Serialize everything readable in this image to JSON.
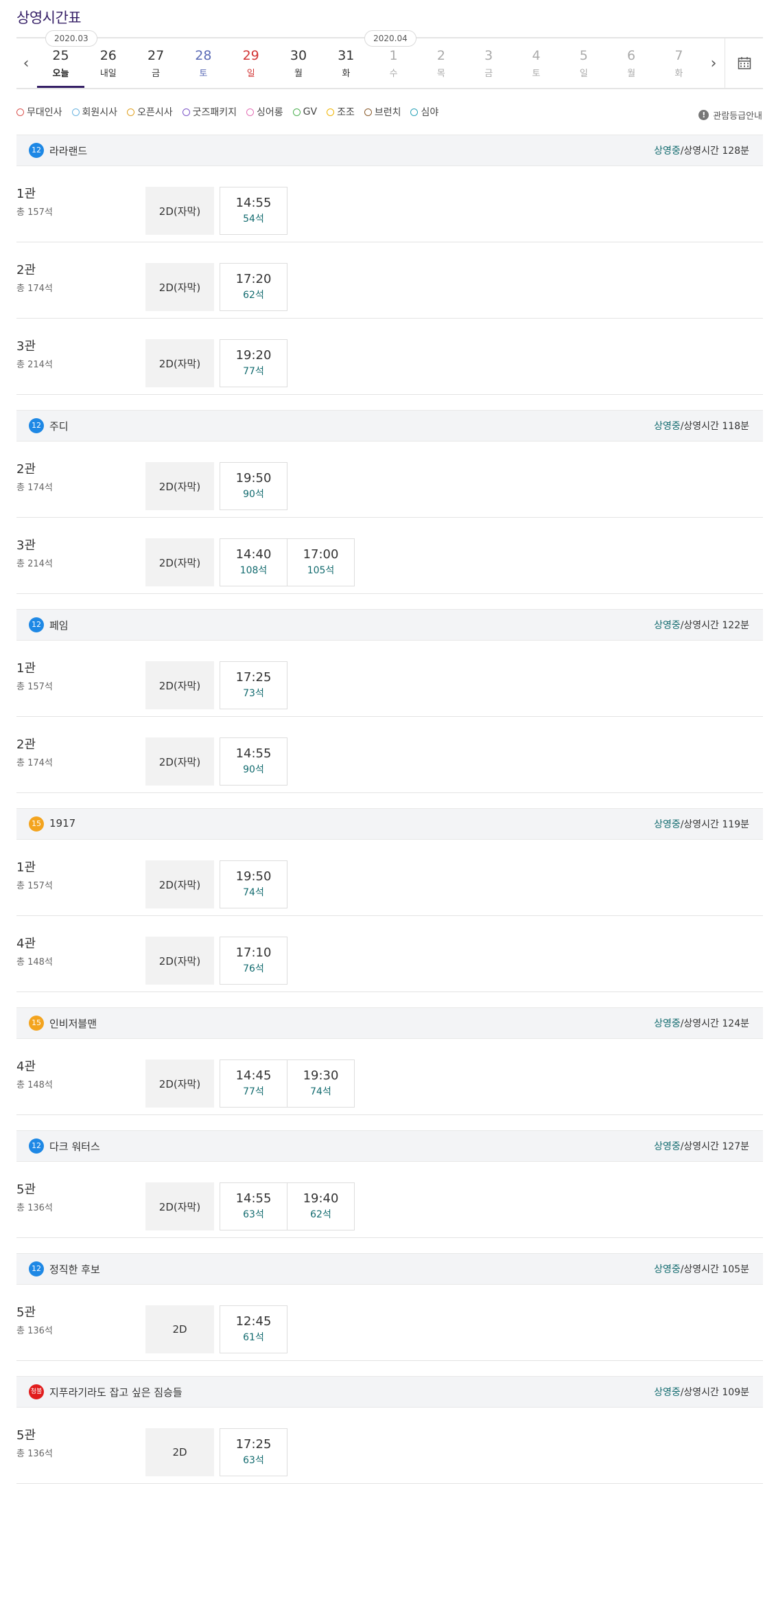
{
  "page_title": "상영시간표",
  "nav": {
    "prev_glyph": "‹",
    "next_glyph": "›"
  },
  "months": [
    "2020.03",
    "2020.04"
  ],
  "days": [
    {
      "num": "25",
      "wk": "오늘",
      "state": "active"
    },
    {
      "num": "26",
      "wk": "내일",
      "state": ""
    },
    {
      "num": "27",
      "wk": "금",
      "state": ""
    },
    {
      "num": "28",
      "wk": "토",
      "state": "sat"
    },
    {
      "num": "29",
      "wk": "일",
      "state": "sun"
    },
    {
      "num": "30",
      "wk": "월",
      "state": ""
    },
    {
      "num": "31",
      "wk": "화",
      "state": ""
    },
    {
      "num": "1",
      "wk": "수",
      "state": "dis"
    },
    {
      "num": "2",
      "wk": "목",
      "state": "dis"
    },
    {
      "num": "3",
      "wk": "금",
      "state": "dis"
    },
    {
      "num": "4",
      "wk": "토",
      "state": "dis"
    },
    {
      "num": "5",
      "wk": "일",
      "state": "dis"
    },
    {
      "num": "6",
      "wk": "월",
      "state": "dis"
    },
    {
      "num": "7",
      "wk": "화",
      "state": "dis"
    }
  ],
  "legend": [
    {
      "label": "무대인사",
      "color": "#d9534f"
    },
    {
      "label": "회원시사",
      "color": "#6bb3e0"
    },
    {
      "label": "오픈시사",
      "color": "#e0a020"
    },
    {
      "label": "굿즈패키지",
      "color": "#7b55c7"
    },
    {
      "label": "싱어롱",
      "color": "#e36fb5"
    },
    {
      "label": "GV",
      "color": "#4caf50"
    },
    {
      "label": "조조",
      "color": "#f0b400"
    },
    {
      "label": "브런치",
      "color": "#8a5a2b"
    },
    {
      "label": "심야",
      "color": "#2aa3b8"
    }
  ],
  "rating_guide": {
    "icon": "!",
    "label": "관람등급안내"
  },
  "movies": [
    {
      "badge": "12",
      "rating": "r12",
      "title": "라라랜드",
      "status": "상영중",
      "runtime": "/상영시간 128분",
      "halls": [
        {
          "hall": "1관",
          "seats": "총 157석",
          "format": "2D(자막)",
          "times": [
            {
              "t": "14:55",
              "s": "54석"
            }
          ]
        },
        {
          "hall": "2관",
          "seats": "총 174석",
          "format": "2D(자막)",
          "times": [
            {
              "t": "17:20",
              "s": "62석"
            }
          ]
        },
        {
          "hall": "3관",
          "seats": "총 214석",
          "format": "2D(자막)",
          "times": [
            {
              "t": "19:20",
              "s": "77석"
            }
          ]
        }
      ]
    },
    {
      "badge": "12",
      "rating": "r12",
      "title": "주디",
      "status": "상영중",
      "runtime": "/상영시간 118분",
      "halls": [
        {
          "hall": "2관",
          "seats": "총 174석",
          "format": "2D(자막)",
          "times": [
            {
              "t": "19:50",
              "s": "90석"
            }
          ]
        },
        {
          "hall": "3관",
          "seats": "총 214석",
          "format": "2D(자막)",
          "times": [
            {
              "t": "14:40",
              "s": "108석"
            },
            {
              "t": "17:00",
              "s": "105석"
            }
          ]
        }
      ]
    },
    {
      "badge": "12",
      "rating": "r12",
      "title": "페임",
      "status": "상영중",
      "runtime": "/상영시간 122분",
      "halls": [
        {
          "hall": "1관",
          "seats": "총 157석",
          "format": "2D(자막)",
          "times": [
            {
              "t": "17:25",
              "s": "73석"
            }
          ]
        },
        {
          "hall": "2관",
          "seats": "총 174석",
          "format": "2D(자막)",
          "times": [
            {
              "t": "14:55",
              "s": "90석"
            }
          ]
        }
      ]
    },
    {
      "badge": "15",
      "rating": "r15",
      "title": "1917",
      "status": "상영중",
      "runtime": "/상영시간 119분",
      "halls": [
        {
          "hall": "1관",
          "seats": "총 157석",
          "format": "2D(자막)",
          "times": [
            {
              "t": "19:50",
              "s": "74석"
            }
          ]
        },
        {
          "hall": "4관",
          "seats": "총 148석",
          "format": "2D(자막)",
          "times": [
            {
              "t": "17:10",
              "s": "76석"
            }
          ]
        }
      ]
    },
    {
      "badge": "15",
      "rating": "r15",
      "title": "인비저블맨",
      "status": "상영중",
      "runtime": "/상영시간 124분",
      "halls": [
        {
          "hall": "4관",
          "seats": "총 148석",
          "format": "2D(자막)",
          "times": [
            {
              "t": "14:45",
              "s": "77석"
            },
            {
              "t": "19:30",
              "s": "74석"
            }
          ]
        }
      ]
    },
    {
      "badge": "12",
      "rating": "r12",
      "title": "다크 워터스",
      "status": "상영중",
      "runtime": "/상영시간 127분",
      "halls": [
        {
          "hall": "5관",
          "seats": "총 136석",
          "format": "2D(자막)",
          "times": [
            {
              "t": "14:55",
              "s": "63석"
            },
            {
              "t": "19:40",
              "s": "62석"
            }
          ]
        }
      ]
    },
    {
      "badge": "12",
      "rating": "r12",
      "title": "정직한 후보",
      "status": "상영중",
      "runtime": "/상영시간 105분",
      "halls": [
        {
          "hall": "5관",
          "seats": "총 136석",
          "format": "2D",
          "times": [
            {
              "t": "12:45",
              "s": "61석"
            }
          ]
        }
      ]
    },
    {
      "badge": "청불",
      "rating": "r19",
      "title": "지푸라기라도 잡고 싶은 짐승들",
      "status": "상영중",
      "runtime": "/상영시간 109분",
      "halls": [
        {
          "hall": "5관",
          "seats": "총 136석",
          "format": "2D",
          "times": [
            {
              "t": "17:25",
              "s": "63석"
            }
          ]
        }
      ]
    }
  ]
}
